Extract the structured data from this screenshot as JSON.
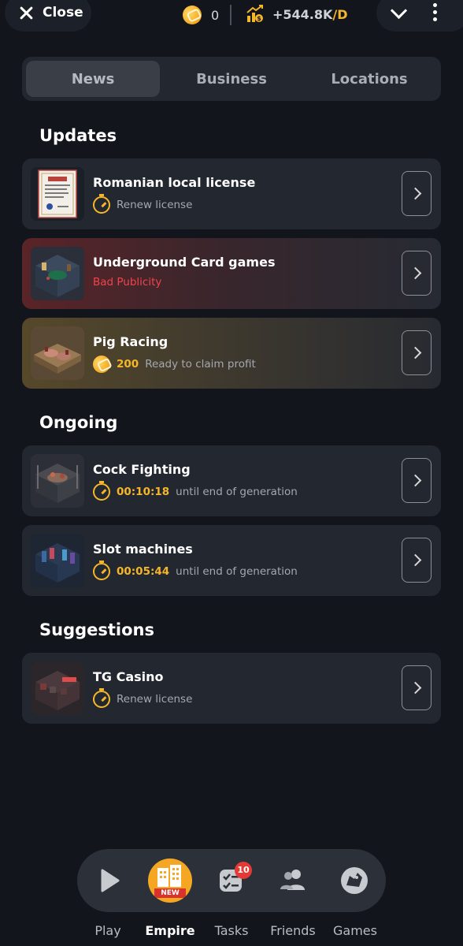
{
  "header": {
    "close_label": "Close",
    "coins": "0",
    "income": "+544.8K",
    "income_unit": "/D"
  },
  "tabs": [
    {
      "label": "News",
      "active": true
    },
    {
      "label": "Business",
      "active": false
    },
    {
      "label": "Locations",
      "active": false
    }
  ],
  "sections": {
    "updates": {
      "title": "Updates",
      "items": [
        {
          "title": "Romanian local license",
          "status": "Renew license",
          "style": "default",
          "icon": "timer-icon"
        },
        {
          "title": "Underground Card games",
          "status": "Bad Publicity",
          "style": "red"
        },
        {
          "title": "Pig Racing",
          "amount": "200",
          "status": "Ready to claim profit",
          "style": "gold",
          "icon": "coin-icon"
        }
      ]
    },
    "ongoing": {
      "title": "Ongoing",
      "items": [
        {
          "title": "Cock Fighting",
          "time": "00:10:18",
          "status": "until end of generation",
          "icon": "timer-icon"
        },
        {
          "title": "Slot machines",
          "time": "00:05:44",
          "status": "until end of generation",
          "icon": "timer-icon"
        }
      ]
    },
    "suggestions": {
      "title": "Suggestions",
      "items": [
        {
          "title": "TG Casino",
          "status": "Renew license",
          "icon": "timer-icon"
        }
      ]
    }
  },
  "nav": {
    "items": [
      {
        "label": "Play",
        "icon": "play-icon",
        "active": false
      },
      {
        "label": "Empire",
        "icon": "buildings-icon",
        "active": true,
        "badge": "NEW"
      },
      {
        "label": "Tasks",
        "icon": "tasks-icon",
        "active": false,
        "badge": "10"
      },
      {
        "label": "Friends",
        "icon": "friends-icon",
        "active": false
      },
      {
        "label": "Games",
        "icon": "games-icon",
        "active": false
      }
    ]
  },
  "colors": {
    "background": "#12151c",
    "card": "#232730",
    "accent_gold": "#f5b62a",
    "alert_red": "#f0444c",
    "badge_red": "#e53935"
  }
}
